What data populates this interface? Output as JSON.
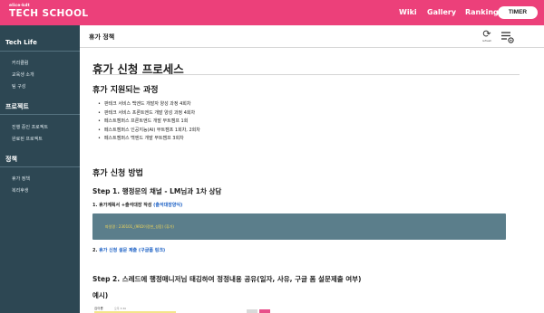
{
  "brand": {
    "small": "elice·kdt",
    "name": "TECH SCHOOL"
  },
  "nav": {
    "wiki": "Wiki",
    "gallery": "Gallery",
    "ranking": "Ranking",
    "timer": "TIMER"
  },
  "sidebar": {
    "sections": [
      {
        "title": "Tech Life",
        "items": [
          "커리큘럼",
          "교육생 소개",
          "팀 구성"
        ]
      },
      {
        "title": "프로젝트",
        "items": [
          "진행 중인 프로젝트",
          "완료된 프로젝트"
        ]
      },
      {
        "title": "정책",
        "items": [
          "휴가 정책",
          "복리후생"
        ]
      }
    ]
  },
  "header": {
    "title": "휴가 정책",
    "refresh_label": "refresh"
  },
  "content": {
    "h1": "휴가 신청 프로세스",
    "supported_heading": "휴가 지원되는 과정",
    "courses": [
      "판테크 서비스 백엔드 개발자 양성 과정 4회차",
      "판테크 서비스 프론트엔드 개발 양성 과정 4회차",
      "페스트캠퍼스 프론트엔드 개발 부트캠프 1회",
      "페스트캠퍼스 인공지능(AI) 부트캠프 1회차, 2회차",
      "페스트캠퍼스 백엔드 개발 부트캠프 3회차"
    ],
    "method_heading": "휴가 신청 방법",
    "step1_heading": "Step 1. 행정문의 채널 - LM님과 1차 상담",
    "step1_item1_prefix": "1. 휴가계획서 +출석대장 작성 ",
    "step1_item1_link": "(출석대장양식)",
    "callout_text": "파일명   :   230101_(9RD이정현_성함) (휴가)",
    "step1_item2_prefix": "2. ",
    "step1_item2_link": "휴가 신청 설문 제출 (구글폼 링크)",
    "step2_heading": "Step 2. 스레드에 행정매니저님 태깅하여 정정내용 공유(일자, 사유, 구글 폼 설문제출 여부)",
    "example_label": "예시)",
    "example_name": "김이름",
    "example_time": "오후 3:30"
  }
}
